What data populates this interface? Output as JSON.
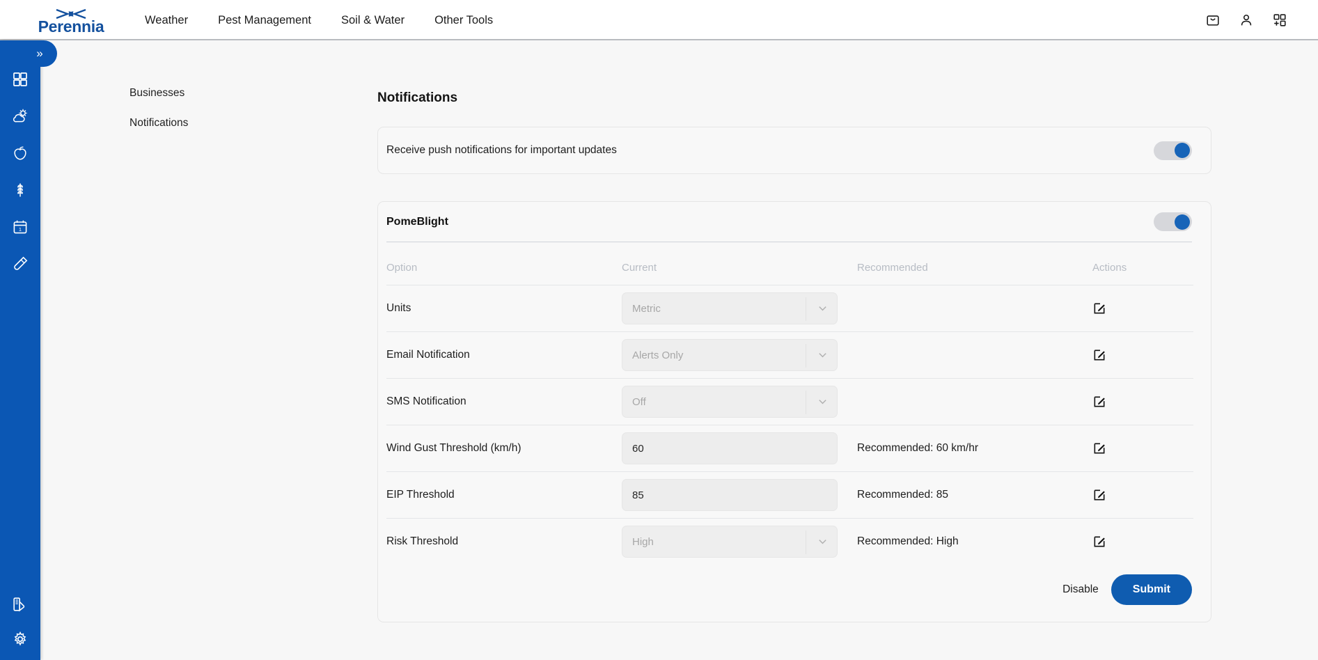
{
  "header": {
    "brand": "Perennia",
    "nav": [
      {
        "label": "Weather"
      },
      {
        "label": "Pest Management"
      },
      {
        "label": "Soil & Water"
      },
      {
        "label": "Other Tools"
      }
    ],
    "icons": [
      {
        "name": "shopping-bag-icon"
      },
      {
        "name": "user-account-icon"
      },
      {
        "name": "apps-grid-plus-icon"
      }
    ]
  },
  "sidebar": {
    "toggle_label": "»",
    "top_items": [
      {
        "name": "dashboard-grid-icon"
      },
      {
        "name": "weather-cloud-sun-icon"
      },
      {
        "name": "apple-fruit-icon"
      },
      {
        "name": "wheat-grain-icon"
      },
      {
        "name": "calendar-icon",
        "badge": "1"
      },
      {
        "name": "test-tube-icon"
      }
    ],
    "bottom_items": [
      {
        "name": "color-palette-icon"
      },
      {
        "name": "settings-gear-icon"
      }
    ],
    "accent_color": "#0b57b4"
  },
  "settings_nav": {
    "items": [
      {
        "label": "Businesses",
        "active": false
      },
      {
        "label": "Notifications",
        "active": true
      }
    ]
  },
  "main": {
    "title": "Notifications",
    "push_card": {
      "label": "Receive push notifications for important updates",
      "toggle_on": true
    },
    "module": {
      "title": "PomeBlight",
      "toggle_on": true,
      "columns": [
        "Option",
        "Current",
        "Recommended",
        "Actions"
      ],
      "rows": [
        {
          "option": "Units",
          "current": "Metric",
          "control": "select",
          "recommended": "",
          "action": "edit-icon"
        },
        {
          "option": "Email Notification",
          "current": "Alerts Only",
          "control": "select",
          "recommended": "",
          "action": "edit-icon"
        },
        {
          "option": "SMS Notification",
          "current": "Off",
          "control": "select",
          "recommended": "",
          "action": "edit-icon"
        },
        {
          "option": "Wind Gust Threshold (km/h)",
          "current": "60",
          "control": "number",
          "recommended": "Recommended: 60 km/hr",
          "action": "edit-icon"
        },
        {
          "option": "EIP Threshold",
          "current": "85",
          "control": "number",
          "recommended": "Recommended: 85",
          "action": "edit-icon"
        },
        {
          "option": "Risk Threshold",
          "current": "High",
          "control": "select",
          "recommended": "Recommended: High",
          "action": "edit-icon"
        }
      ],
      "footer": {
        "disable_label": "Disable",
        "submit_label": "Submit"
      }
    }
  },
  "colors": {
    "brand_blue": "#14519e",
    "sidebar_blue": "#0b57b4",
    "submit_blue": "#0f5cb0",
    "toggle_knob": "#1764b8",
    "page_bg": "#f7f7f7"
  }
}
